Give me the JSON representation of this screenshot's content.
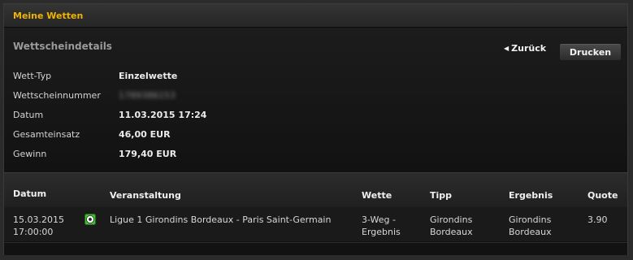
{
  "header": {
    "title": "Meine Wetten"
  },
  "details": {
    "section_title": "Wettscheindetails",
    "back_label": "Zurück",
    "print_label": "Drucken",
    "rows": [
      {
        "label": "Wett-Typ",
        "value": "Einzelwette"
      },
      {
        "label": "Wettscheinnummer",
        "value": "1789386153"
      },
      {
        "label": "Datum",
        "value": "11.03.2015 17:24"
      },
      {
        "label": "Gesamteinsatz",
        "value": "46,00 EUR"
      },
      {
        "label": "Gewinn",
        "value": "179,40 EUR"
      }
    ]
  },
  "table": {
    "columns": {
      "date": "Datum",
      "event": "Veranstaltung",
      "bet": "Wette",
      "tip": "Tipp",
      "result": "Ergebnis",
      "odds": "Quote"
    },
    "rows": [
      {
        "date_line1": "15.03.2015",
        "date_line2": "17:00:00",
        "sport_icon": "soccer-ball-icon",
        "event": "Ligue 1 Girondins Bordeaux - Paris Saint-Germain",
        "bet_line1": "3-Weg -",
        "bet_line2": "Ergebnis",
        "tip_line1": "Girondins",
        "tip_line2": "Bordeaux",
        "result_line1": "Girondins",
        "result_line2": "Bordeaux",
        "odds": "3.90"
      }
    ]
  },
  "colors": {
    "title": "#f0b400",
    "background": "#101010",
    "icon_green": "#3fbf2f"
  }
}
